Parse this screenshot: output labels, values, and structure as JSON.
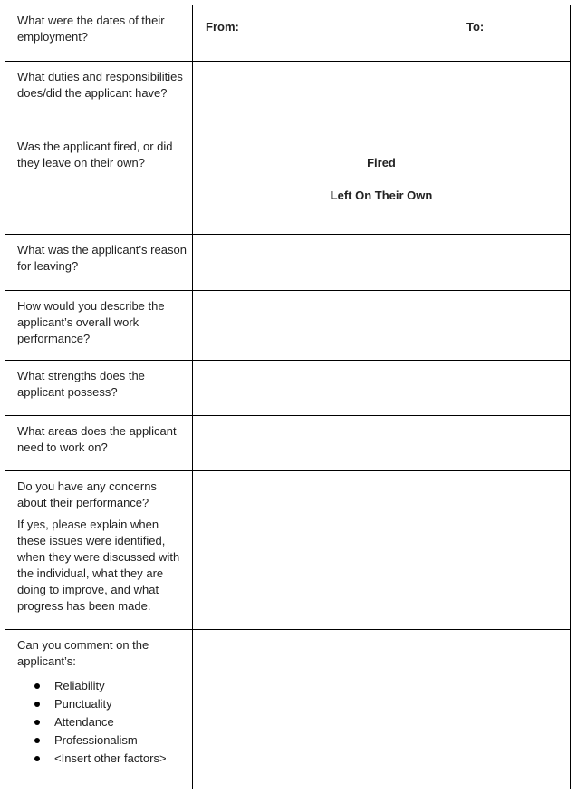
{
  "table": {
    "rows": [
      {
        "question": [
          "What were the dates of their employment?"
        ],
        "answer_type": "dates",
        "from_label": "From:",
        "to_label": "To:"
      },
      {
        "question": [
          "What duties and responsibilities does/did the applicant have?"
        ],
        "answer_type": "blank"
      },
      {
        "question": [
          "Was the applicant fired, or did they leave on their own?"
        ],
        "answer_type": "choices",
        "choices": [
          "Fired",
          "Left On Their Own"
        ]
      },
      {
        "question": [
          "What was the applicant’s reason for leaving?"
        ],
        "answer_type": "blank"
      },
      {
        "question": [
          "How would you describe the applicant’s overall work performance?"
        ],
        "answer_type": "blank"
      },
      {
        "question": [
          "What strengths does the applicant possess?"
        ],
        "answer_type": "blank"
      },
      {
        "question": [
          "What areas does the applicant need to work on?"
        ],
        "answer_type": "blank"
      },
      {
        "question": [
          "Do you have any concerns about their performance?",
          "If yes, please explain when these issues were identified, when they were discussed with the individual, what they are doing to improve, and what progress has been made."
        ],
        "answer_type": "blank"
      },
      {
        "question": [
          "Can you comment on the applicant’s:"
        ],
        "bullets": [
          "Reliability",
          "Punctuality",
          "Attendance",
          "Professionalism",
          "<Insert other factors>"
        ],
        "answer_type": "blank"
      }
    ]
  }
}
